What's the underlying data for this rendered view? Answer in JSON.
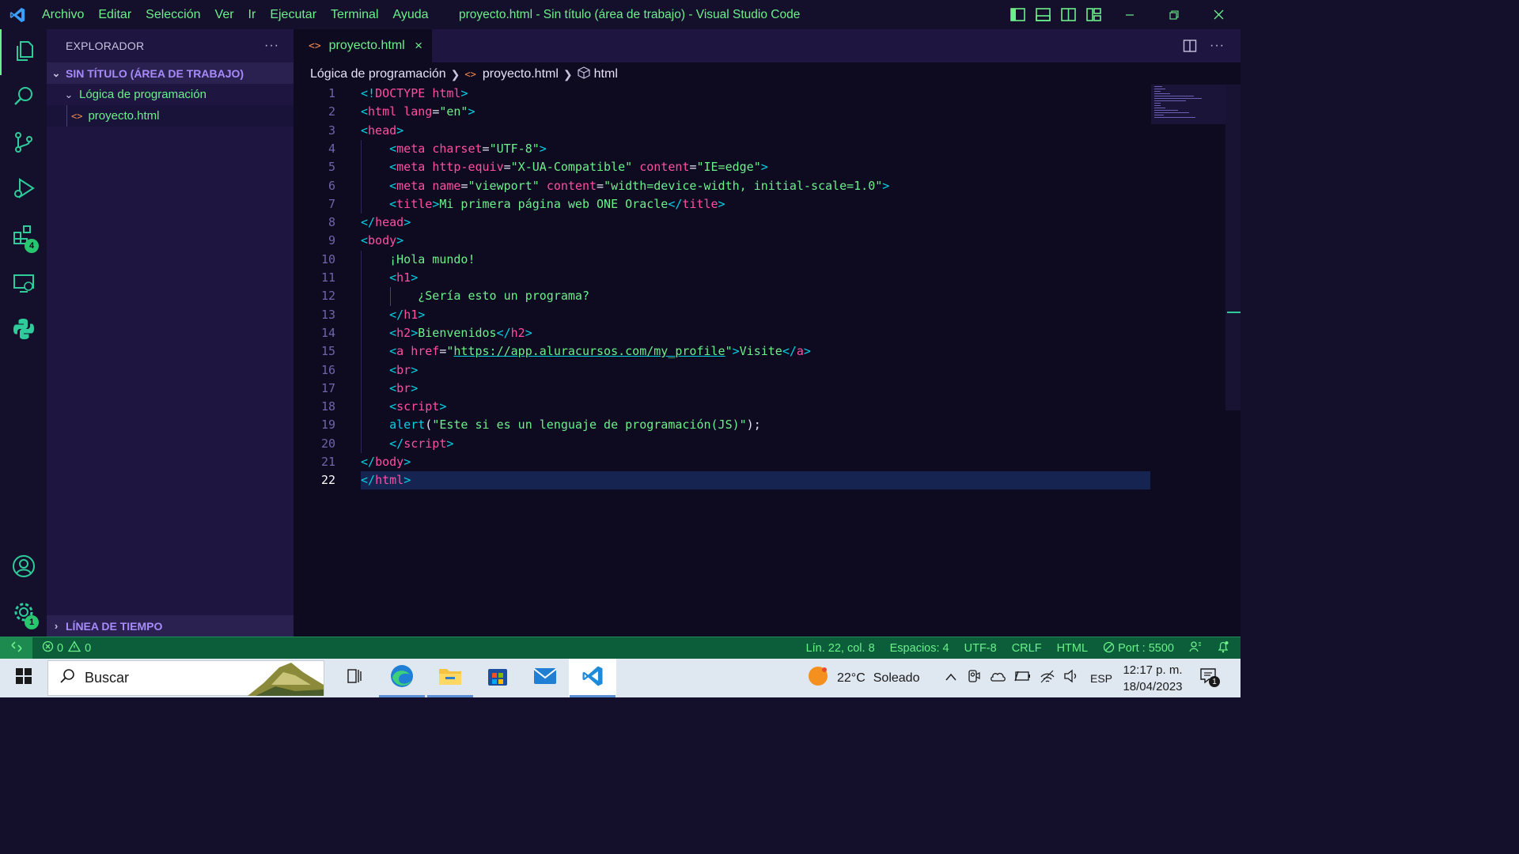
{
  "titlebar": {
    "menu": [
      "Archivo",
      "Editar",
      "Selección",
      "Ver",
      "Ir",
      "Ejecutar",
      "Terminal",
      "Ayuda"
    ],
    "window_title": "proyecto.html - Sin título (área de trabajo) - Visual Studio Code"
  },
  "activity_bar": {
    "items": [
      "files-icon",
      "search-icon",
      "source-control-icon",
      "run-debug-icon",
      "extensions-icon",
      "remote-explorer-icon",
      "python-icon"
    ],
    "extensions_badge": "4",
    "settings_badge": "1"
  },
  "sidebar": {
    "title": "EXPLORADOR",
    "more": "···",
    "workspace": "SIN TÍTULO (ÁREA DE TRABAJO)",
    "folder": "Lógica de programación",
    "file": "proyecto.html",
    "timeline": "LÍNEA DE TIEMPO"
  },
  "editor": {
    "tab_label": "proyecto.html",
    "tab_icon": "<>",
    "close": "×",
    "breadcrumb": [
      "Lógica de programación",
      "proyecto.html",
      "html"
    ],
    "current_line": 22,
    "lines": [
      {
        "n": "1",
        "segs": [
          [
            "br",
            "<!"
          ],
          [
            "tag",
            "DOCTYPE "
          ],
          [
            "attr",
            "html"
          ],
          [
            "br",
            ">"
          ]
        ]
      },
      {
        "n": "2",
        "segs": [
          [
            "br",
            "<"
          ],
          [
            "tag",
            "html "
          ],
          [
            "attr",
            "lang"
          ],
          [
            "pun",
            "="
          ],
          [
            "str",
            "\"en\""
          ],
          [
            "br",
            ">"
          ]
        ]
      },
      {
        "n": "3",
        "segs": [
          [
            "br",
            "<"
          ],
          [
            "tag",
            "head"
          ],
          [
            "br",
            ">"
          ]
        ]
      },
      {
        "n": "4",
        "segs": [
          [
            "pun",
            "    "
          ],
          [
            "br",
            "<"
          ],
          [
            "tag",
            "meta "
          ],
          [
            "attr",
            "charset"
          ],
          [
            "pun",
            "="
          ],
          [
            "str",
            "\"UTF-8\""
          ],
          [
            "br",
            ">"
          ]
        ]
      },
      {
        "n": "5",
        "segs": [
          [
            "pun",
            "    "
          ],
          [
            "br",
            "<"
          ],
          [
            "tag",
            "meta "
          ],
          [
            "attr",
            "http-equiv"
          ],
          [
            "pun",
            "="
          ],
          [
            "str",
            "\"X-UA-Compatible\" "
          ],
          [
            "attr",
            "content"
          ],
          [
            "pun",
            "="
          ],
          [
            "str",
            "\"IE=edge\""
          ],
          [
            "br",
            ">"
          ]
        ]
      },
      {
        "n": "6",
        "segs": [
          [
            "pun",
            "    "
          ],
          [
            "br",
            "<"
          ],
          [
            "tag",
            "meta "
          ],
          [
            "attr",
            "name"
          ],
          [
            "pun",
            "="
          ],
          [
            "str",
            "\"viewport\" "
          ],
          [
            "attr",
            "content"
          ],
          [
            "pun",
            "="
          ],
          [
            "str",
            "\"width=device-width, initial-scale=1.0\""
          ],
          [
            "br",
            ">"
          ]
        ]
      },
      {
        "n": "7",
        "segs": [
          [
            "pun",
            "    "
          ],
          [
            "br",
            "<"
          ],
          [
            "tag",
            "title"
          ],
          [
            "br",
            ">"
          ],
          [
            "text",
            "Mi primera página web ONE Oracle"
          ],
          [
            "br",
            "</"
          ],
          [
            "tag",
            "title"
          ],
          [
            "br",
            ">"
          ]
        ]
      },
      {
        "n": "8",
        "segs": [
          [
            "br",
            "</"
          ],
          [
            "tag",
            "head"
          ],
          [
            "br",
            ">"
          ]
        ]
      },
      {
        "n": "9",
        "segs": [
          [
            "br",
            "<"
          ],
          [
            "tag",
            "body"
          ],
          [
            "br",
            ">"
          ]
        ]
      },
      {
        "n": "10",
        "segs": [
          [
            "pun",
            "    "
          ],
          [
            "text",
            "¡Hola mundo!"
          ]
        ]
      },
      {
        "n": "11",
        "segs": [
          [
            "pun",
            "    "
          ],
          [
            "br",
            "<"
          ],
          [
            "tag",
            "h1"
          ],
          [
            "br",
            ">"
          ]
        ]
      },
      {
        "n": "12",
        "segs": [
          [
            "pun",
            "        "
          ],
          [
            "text",
            "¿Sería esto un programa?"
          ]
        ]
      },
      {
        "n": "13",
        "segs": [
          [
            "pun",
            "    "
          ],
          [
            "br",
            "</"
          ],
          [
            "tag",
            "h1"
          ],
          [
            "br",
            ">"
          ]
        ]
      },
      {
        "n": "14",
        "segs": [
          [
            "pun",
            "    "
          ],
          [
            "br",
            "<"
          ],
          [
            "tag",
            "h2"
          ],
          [
            "br",
            ">"
          ],
          [
            "text",
            "Bienvenidos"
          ],
          [
            "br",
            "</"
          ],
          [
            "tag",
            "h2"
          ],
          [
            "br",
            ">"
          ]
        ]
      },
      {
        "n": "15",
        "segs": [
          [
            "pun",
            "    "
          ],
          [
            "br",
            "<"
          ],
          [
            "tag",
            "a "
          ],
          [
            "attr",
            "href"
          ],
          [
            "pun",
            "="
          ],
          [
            "str",
            "\""
          ],
          [
            "url",
            "https://app.aluracursos.com/my_profile"
          ],
          [
            "str",
            "\""
          ],
          [
            "br",
            ">"
          ],
          [
            "text",
            "Visite"
          ],
          [
            "br",
            "</"
          ],
          [
            "tag",
            "a"
          ],
          [
            "br",
            ">"
          ]
        ]
      },
      {
        "n": "16",
        "segs": [
          [
            "pun",
            "    "
          ],
          [
            "br",
            "<"
          ],
          [
            "tag",
            "br"
          ],
          [
            "br",
            ">"
          ]
        ]
      },
      {
        "n": "17",
        "segs": [
          [
            "pun",
            "    "
          ],
          [
            "br",
            "<"
          ],
          [
            "tag",
            "br"
          ],
          [
            "br",
            ">"
          ]
        ]
      },
      {
        "n": "18",
        "segs": [
          [
            "pun",
            "    "
          ],
          [
            "br",
            "<"
          ],
          [
            "tag",
            "script"
          ],
          [
            "br",
            ">"
          ]
        ]
      },
      {
        "n": "19",
        "segs": [
          [
            "pun",
            "    "
          ],
          [
            "fn",
            "alert"
          ],
          [
            "pun",
            "("
          ],
          [
            "str",
            "\"Este si es un lenguaje de programación(JS)\""
          ],
          [
            "pun",
            ");"
          ]
        ]
      },
      {
        "n": "20",
        "segs": [
          [
            "pun",
            "    "
          ],
          [
            "br",
            "</"
          ],
          [
            "tag",
            "script"
          ],
          [
            "br",
            ">"
          ]
        ]
      },
      {
        "n": "21",
        "segs": [
          [
            "br",
            "</"
          ],
          [
            "tag",
            "body"
          ],
          [
            "br",
            ">"
          ]
        ]
      },
      {
        "n": "22",
        "segs": [
          [
            "br",
            "</"
          ],
          [
            "tag",
            "html"
          ],
          [
            "br",
            ">"
          ]
        ]
      }
    ]
  },
  "statusbar": {
    "errors": "0",
    "warnings": "0",
    "position": "Lín. 22, col. 8",
    "spaces": "Espacios: 4",
    "encoding": "UTF-8",
    "eol": "CRLF",
    "language": "HTML",
    "port": "Port : 5500"
  },
  "taskbar": {
    "search_placeholder": "Buscar",
    "weather_temp": "22°C",
    "weather_text": "Soleado",
    "language": "ESP",
    "time": "12:17 p. m.",
    "date": "18/04/2023",
    "notifications": "1"
  },
  "colors": {
    "accent": "#6cf08b",
    "tag": "#ff4fa3",
    "bracket": "#00d2e6",
    "workspace": "#a78bfa",
    "statusbar": "#0c5d3a"
  }
}
